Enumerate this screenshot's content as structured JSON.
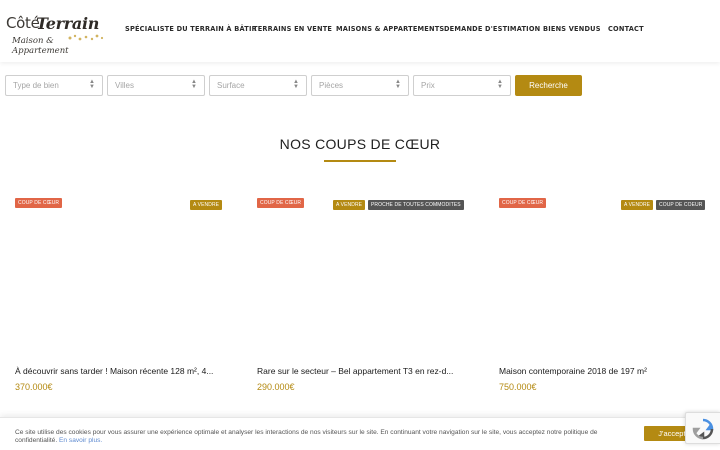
{
  "brand": {
    "name_part1": "Côté",
    "name_part2": "Terrain",
    "tagline": "Maison & Appartement"
  },
  "nav": {
    "items": [
      "SPÉCIALISTE DU TERRAIN À BÂTIR",
      "TERRAINS EN VENTE",
      "MAISONS & APPARTEMENTS",
      "DEMANDE D'ESTIMATION",
      "BIENS VENDUS",
      "CONTACT"
    ]
  },
  "search": {
    "type_placeholder": "Type de bien",
    "villes_placeholder": "Villes",
    "surface_placeholder": "Surface",
    "pieces_placeholder": "Pièces",
    "prix_placeholder": "Prix",
    "button_label": "Recherche"
  },
  "section": {
    "title": "NOS COUPS DE CŒUR"
  },
  "cards": [
    {
      "badge_left": "COUP DE CŒUR",
      "badges_right": [
        "A VENDRE"
      ],
      "title": "À découvrir sans tarder ! Maison récente 128 m², 4...",
      "price": "370.000€"
    },
    {
      "badge_left": "COUP DE CŒUR",
      "badges_right": [
        "A VENDRE",
        "PROCHE DE TOUTES COMMODITES"
      ],
      "title": "Rare sur le secteur – Bel appartement T3 en rez-d...",
      "price": "290.000€"
    },
    {
      "badge_left": "COUP DE CŒUR",
      "badges_right": [
        "A VENDRE",
        "COUP DE COEUR"
      ],
      "title": "Maison contemporaine 2018 de 197 m²",
      "price": "750.000€"
    }
  ],
  "cookie": {
    "text": "Ce site utilise des cookies pour vous assurer une expérience optimale et analyser les interactions de nos visiteurs sur le site. En continuant votre navigation sur le site, vous acceptez notre politique de confidentialité.",
    "link": "En savoir plus.",
    "accept_label": "J'accepte"
  },
  "colors": {
    "accent": "#b48a12",
    "badge_red": "#e16647",
    "badge_dark": "#555555"
  }
}
